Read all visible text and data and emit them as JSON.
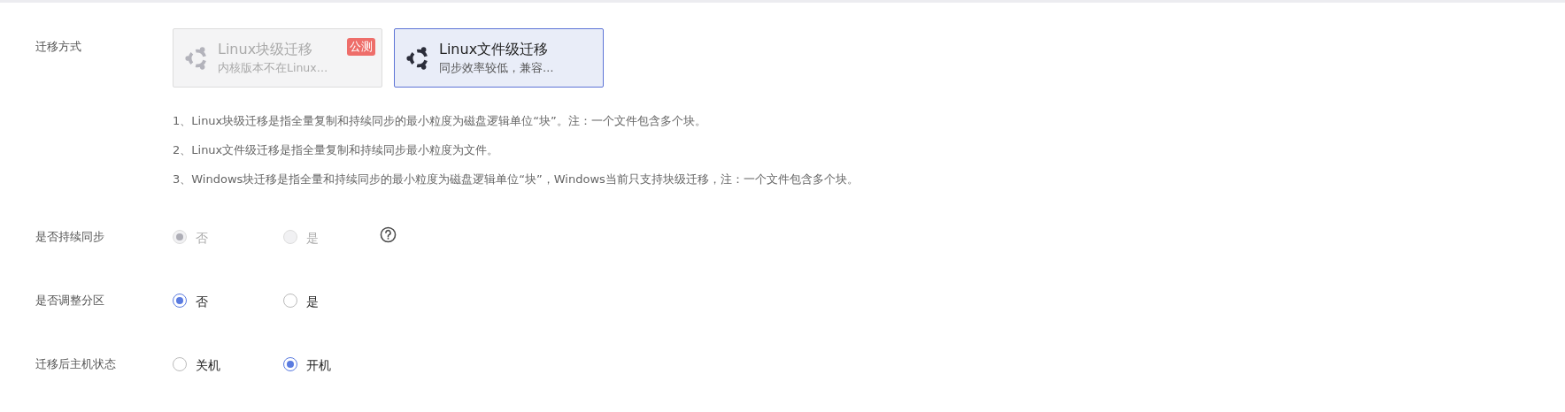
{
  "migration_method": {
    "label": "迁移方式",
    "options": [
      {
        "title": "Linux块级迁移",
        "description": "内核版本不在Linux…",
        "badge": "公测",
        "disabled": true,
        "selected": false
      },
      {
        "title": "Linux文件级迁移",
        "description": "同步效率较低，兼容…",
        "disabled": false,
        "selected": true
      }
    ]
  },
  "notes": [
    "1、Linux块级迁移是指全量复制和持续同步的最小粒度为磁盘逻辑单位“块”。注：一个文件包含多个块。",
    "2、Linux文件级迁移是指全量复制和持续同步最小粒度为文件。",
    "3、Windows块迁移是指全量和持续同步的最小粒度为磁盘逻辑单位“块”，Windows当前只支持块级迁移，注：一个文件包含多个块。"
  ],
  "fields": [
    {
      "label": "是否持续同步",
      "disabled": true,
      "has_help": true,
      "options": [
        {
          "label": "否",
          "selected": true
        },
        {
          "label": "是",
          "selected": false
        }
      ]
    },
    {
      "label": "是否调整分区",
      "disabled": false,
      "has_help": false,
      "options": [
        {
          "label": "否",
          "selected": true
        },
        {
          "label": "是",
          "selected": false
        }
      ]
    },
    {
      "label": "迁移后主机状态",
      "disabled": false,
      "has_help": false,
      "options": [
        {
          "label": "关机",
          "selected": false
        },
        {
          "label": "开机",
          "selected": true
        }
      ]
    }
  ]
}
